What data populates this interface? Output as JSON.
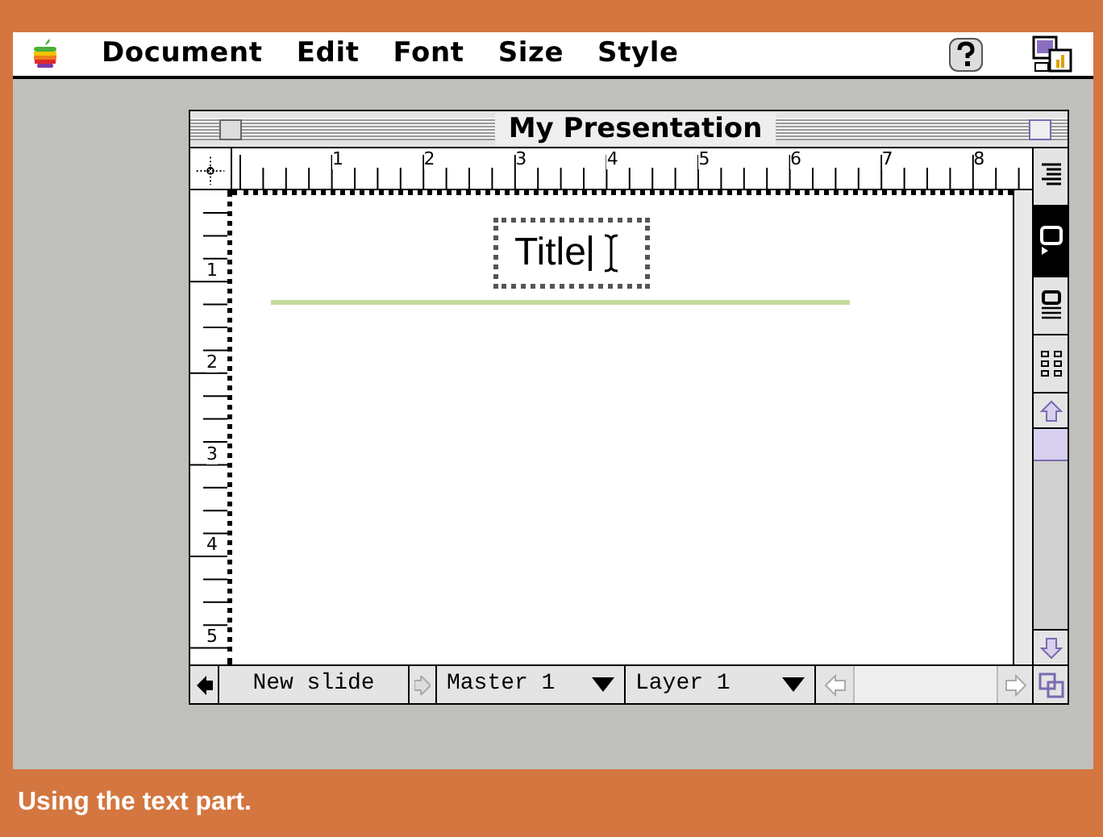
{
  "menu_bar": {
    "items": [
      "Document",
      "Edit",
      "Font",
      "Size",
      "Style"
    ]
  },
  "window": {
    "title": "My Presentation"
  },
  "ruler": {
    "horizontal": [
      "1",
      "2",
      "3",
      "4",
      "5",
      "6",
      "7",
      "8"
    ],
    "vertical": [
      "1",
      "2",
      "3",
      "4",
      "5"
    ]
  },
  "slide": {
    "text": "Title"
  },
  "tool_palette": [
    {
      "kind": "outline",
      "selected": false
    },
    {
      "kind": "slide",
      "selected": true
    },
    {
      "kind": "notes",
      "selected": false
    },
    {
      "kind": "sorter",
      "selected": false
    }
  ],
  "bottom_bar": {
    "new_slide": "New slide",
    "master": "Master 1",
    "layer": "Layer 1"
  },
  "caption": "Using the text part."
}
